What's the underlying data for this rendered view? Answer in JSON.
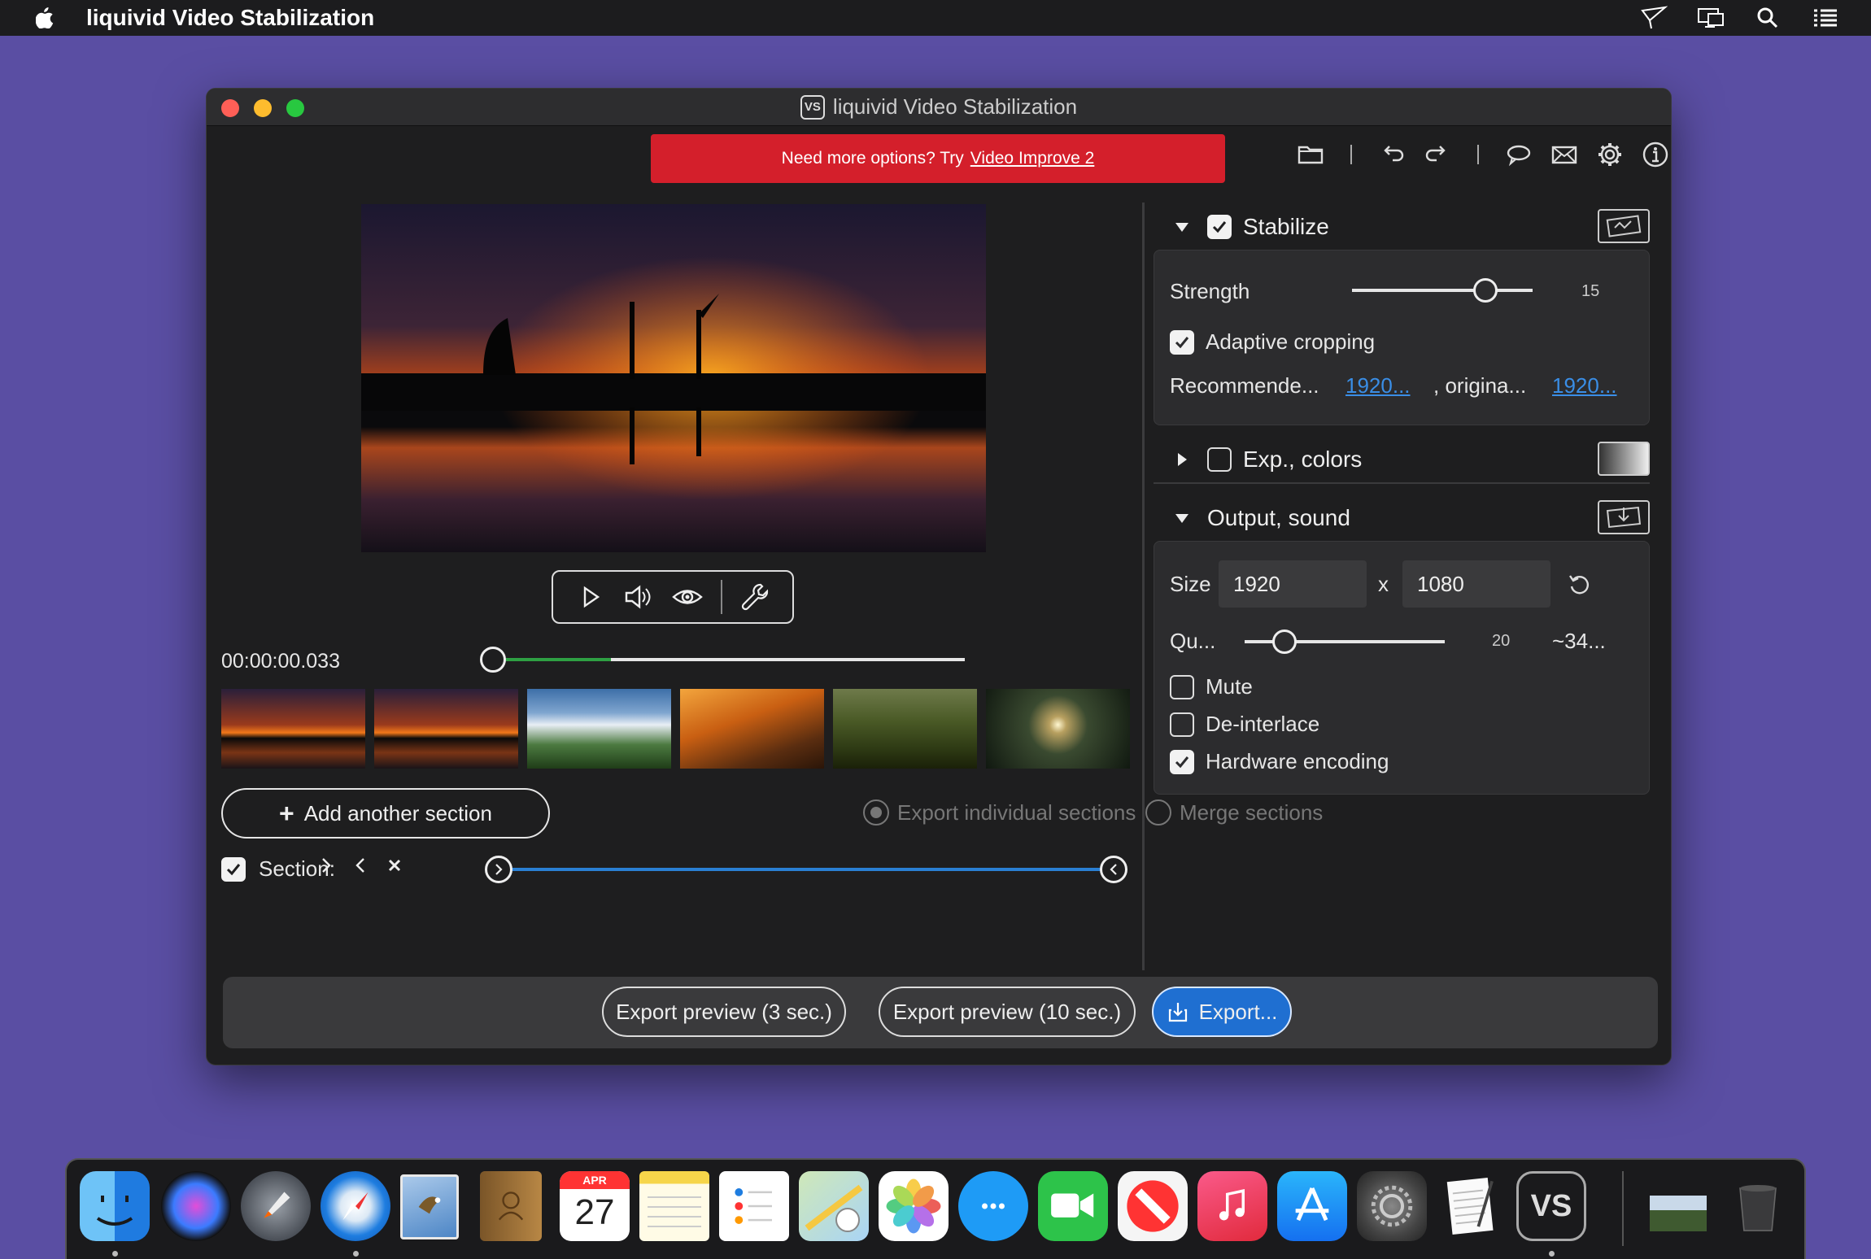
{
  "menubar": {
    "app_name": "liquivid Video Stabilization"
  },
  "window": {
    "title": "liquivid Video Stabilization",
    "title_icon": "VS"
  },
  "promo": {
    "text": "Need more options? Try",
    "link": "Video Improve 2",
    "color": "#d41f2b"
  },
  "toolbar_icons": [
    "folder-icon",
    "undo-icon",
    "redo-icon",
    "speech-bubble-icon",
    "mail-icon",
    "gear-icon",
    "info-icon"
  ],
  "player": {
    "timecode": "00:00:00.033",
    "playhead_fraction": 0.0,
    "buffered_fraction": 0.25
  },
  "sections": {
    "add_label": "Add another section",
    "export_individual": "Export individual sections",
    "merge": "Merge sections",
    "section_label": "Section:"
  },
  "stabilize": {
    "title": "Stabilize",
    "strength_label": "Strength",
    "strength_value": "15",
    "strength_fraction": 0.74,
    "adaptive_label": "Adaptive cropping",
    "recommended_label": "Recommende...",
    "recommended_value": "1920...",
    "original_label": ", origina...",
    "original_value": "1920..."
  },
  "exp": {
    "title": "Exp., colors"
  },
  "output": {
    "title": "Output, sound",
    "size_label": "Size",
    "width": "1920",
    "x_label": "x",
    "height": "1080",
    "quality_label": "Qu...",
    "quality_value": "20",
    "quality_fraction": 0.2,
    "estimate": "~34...",
    "mute_label": "Mute",
    "deinterlace_label": "De-interlace",
    "hw_label": "Hardware encoding"
  },
  "bottom": {
    "preview3": "Export preview (3 sec.)",
    "preview10": "Export preview (10 sec.)",
    "export": "Export..."
  },
  "dock": {
    "calendar_month": "APR",
    "calendar_day": "27",
    "vs_label": "VS"
  },
  "colors": {
    "accent_blue": "#1f6fd1",
    "progress_green": "#2ea043",
    "section_blue": "#2a7fd3"
  }
}
